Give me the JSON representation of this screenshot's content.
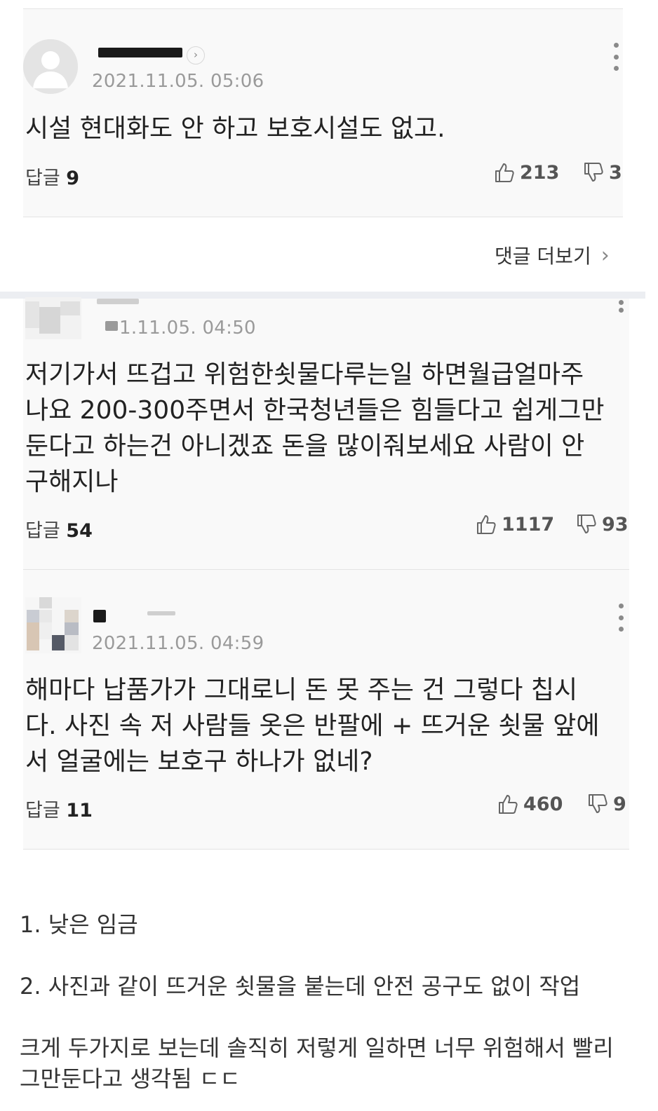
{
  "comments": [
    {
      "time": "2021.11.05. 05:06",
      "text": "시설 현대화도 안 하고 보호시설도 없고.",
      "reply_label": "답글",
      "reply_count": "9",
      "likes": "213",
      "dislikes": "3"
    },
    {
      "time": "1.11.05. 04:50",
      "text": "저기가서 뜨겁고 위험한쇳물다루는일 하면월급얼마주\n나요 200-300주면서 한국청년들은 힘들다고 쉽게그만\n둔다고 하는건 아니겠죠 돈을 많이줘보세요 사람이 안\n구해지나",
      "reply_label": "답글",
      "reply_count": "54",
      "likes": "1117",
      "dislikes": "93"
    },
    {
      "time": "2021.11.05. 04:59",
      "text": "해마다 납품가가 그대로니 돈 못 주는 건 그렇다 칩시\n다. 사진 속 저 사람들 옷은 반팔에 + 뜨거운 쇳물 앞에\n서 얼굴에는 보호구 하나가 없네?",
      "reply_label": "답글",
      "reply_count": "11",
      "likes": "460",
      "dislikes": "9"
    }
  ],
  "more_comments_label": "댓글 더보기",
  "notes": [
    "1. 낮은 임금",
    "2. 사진과 같이 뜨거운 쇳물을 붙는데 안전 공구도 없이 작업",
    "크게 두가지로 보는데 솔직히 저렇게 일하면 너무 위험해서 빨리\n그만둔다고 생각됨 ㄷㄷ"
  ]
}
